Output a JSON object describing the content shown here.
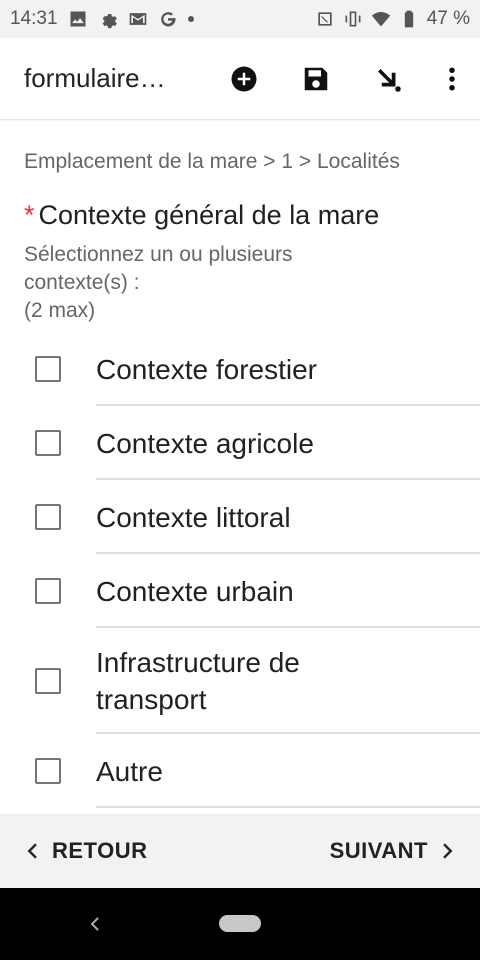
{
  "status_bar": {
    "time": "14:31",
    "battery": "47 %",
    "left_icons": [
      "image-icon",
      "settings-icon",
      "gmail-icon",
      "google-icon",
      "dot-icon"
    ],
    "right_icons": [
      "nfc-icon",
      "vibrate-icon",
      "wifi-icon",
      "battery-icon"
    ]
  },
  "app_bar": {
    "title": "formulaire…",
    "actions": [
      "add-circle-icon",
      "save-icon",
      "go-to-icon",
      "more-vert-icon"
    ]
  },
  "form": {
    "breadcrumb": "Emplacement de la mare > 1 > Localités",
    "required_mark": "*",
    "question": "Contexte général de la mare",
    "hint_line1": "Sélectionnez un ou plusieurs",
    "hint_line2": "contexte(s) :",
    "hint_line3": "(2 max)",
    "options": [
      {
        "label": "Contexte forestier",
        "checked": false
      },
      {
        "label": "Contexte agricole",
        "checked": false
      },
      {
        "label": "Contexte littoral",
        "checked": false
      },
      {
        "label": "Contexte urbain",
        "checked": false
      },
      {
        "label": "Infrastructure de transport",
        "checked": false
      },
      {
        "label": "Autre",
        "checked": false
      }
    ]
  },
  "navigation": {
    "back_label": "RETOUR",
    "next_label": "SUIVANT"
  },
  "colors": {
    "required": "#e53935",
    "status_bar_bg": "#f2f2f2",
    "bottom_bar_bg": "#f2f2f2"
  }
}
